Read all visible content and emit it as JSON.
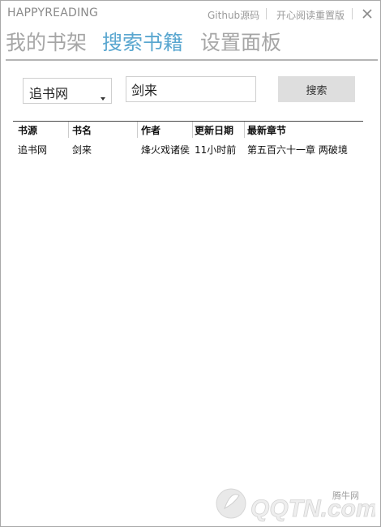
{
  "app": {
    "title": "HAPPYREADING",
    "links": [
      "Github源码",
      "开心阅读重置版"
    ]
  },
  "nav": {
    "tabs": [
      {
        "label": "我的书架",
        "active": false
      },
      {
        "label": "搜索书籍",
        "active": true
      },
      {
        "label": "设置面板",
        "active": false
      }
    ]
  },
  "search": {
    "source_selected": "追书网",
    "query": "剑来",
    "button_label": "搜索"
  },
  "results": {
    "columns": [
      "书源",
      "书名",
      "作者",
      "更新日期",
      "最新章节"
    ],
    "rows": [
      [
        "追书网",
        "剑来",
        "烽火戏诸侯",
        "11小时前",
        "第五百六十一章 两破境"
      ]
    ]
  },
  "watermark": {
    "text": "QQTN.com",
    "site_label": "腾牛网"
  },
  "colors": {
    "accent": "#5aa7d0",
    "inactive_tab": "#a6a6a6"
  }
}
